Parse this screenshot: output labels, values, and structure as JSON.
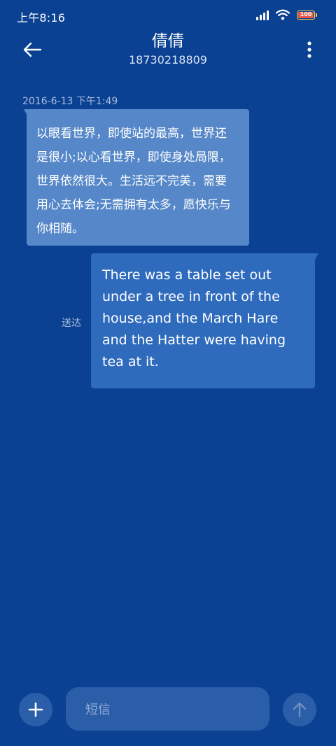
{
  "status_bar": {
    "time": "上午8:16",
    "battery_text": "100",
    "battery_level": 1.0
  },
  "header": {
    "contact_name": "倩倩",
    "phone_number": "18730218809",
    "back_icon": "back-arrow-icon",
    "menu_icon": "more-vertical-icon"
  },
  "conversation": {
    "timestamp": "2016-6-13 下午1:49",
    "messages": [
      {
        "direction": "incoming",
        "text": "以眼看世界，即使站的最高，世界还是很小;以心看世界，即使身处局限，世界依然很大。生活远不完美，需要用心去体会;无需拥有太多，愿快乐与你相随。"
      },
      {
        "direction": "outgoing",
        "text": "There was a table set out under a tree in front of the house,and the March Hare and the Hatter were having tea at it.",
        "status": "送达"
      }
    ]
  },
  "composer": {
    "placeholder": "短信",
    "add_icon": "plus-icon",
    "send_icon": "send-arrow-up-icon"
  },
  "colors": {
    "background": "#0b4192",
    "incoming_bubble": "#5688c9",
    "outgoing_bubble": "#2f6bbd",
    "composer_fill": "#2a5ea8"
  }
}
